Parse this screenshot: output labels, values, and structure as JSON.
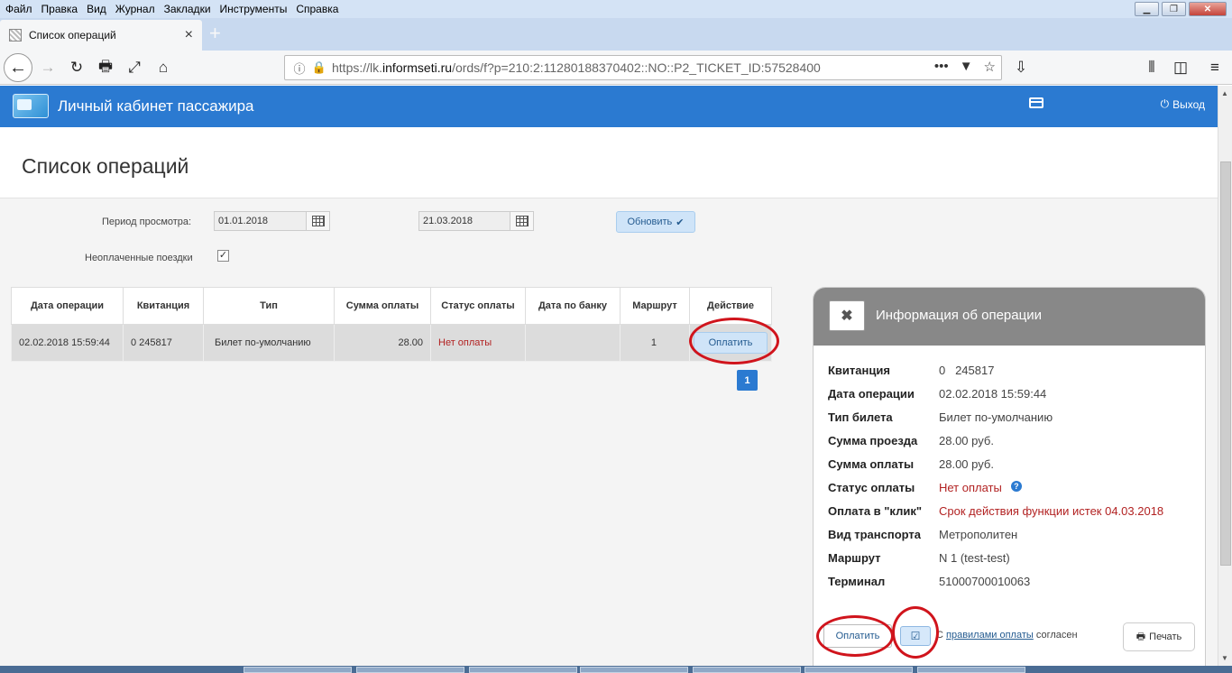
{
  "browser": {
    "menu": [
      "Файл",
      "Правка",
      "Вид",
      "Журнал",
      "Закладки",
      "Инструменты",
      "Справка"
    ],
    "tab_title": "Список операций",
    "url_prefix": "https://lk.",
    "url_host": "informseti.ru",
    "url_rest": "/ords/f?p=210:2:11280188370402::NO::P2_TICKET_ID:57528400"
  },
  "app": {
    "title": "Личный кабинет пассажира",
    "logout": "Выход"
  },
  "page": {
    "title": "Список операций"
  },
  "filter": {
    "period_label": "Период просмотра:",
    "date_from": "01.01.2018",
    "date_to": "21.03.2018",
    "refresh_label": "Обновить",
    "unpaid_label": "Неоплаченные поездки",
    "unpaid_checked": true
  },
  "table": {
    "headers": [
      "Дата операции",
      "Квитанция",
      "Тип",
      "Сумма оплаты",
      "Статус оплаты",
      "Дата по банку",
      "Маршрут",
      "Действие"
    ],
    "rows": [
      {
        "date": "02.02.2018 15:59:44",
        "receipt": "0 245817",
        "type": "Билет по-умолчанию",
        "amount": "28.00",
        "status": "Нет оплаты",
        "bank_date": "",
        "route": "1",
        "action": "Оплатить"
      }
    ],
    "page": "1"
  },
  "info": {
    "title": "Информация об операции",
    "fields": [
      {
        "label": "Квитанция",
        "value": "0   245817"
      },
      {
        "label": "Дата операции",
        "value": "02.02.2018 15:59:44"
      },
      {
        "label": "Тип билета",
        "value": "Билет по-умолчанию"
      },
      {
        "label": "Сумма проезда",
        "value": "28.00 руб."
      },
      {
        "label": "Сумма оплаты",
        "value": "28.00 руб."
      },
      {
        "label": "Статус оплаты",
        "value": "Нет оплаты"
      },
      {
        "label": "Оплата в \"клик\"",
        "value": "Срок действия функции истек 04.03.2018"
      },
      {
        "label": "Вид транспорта",
        "value": "Метрополитен"
      },
      {
        "label": "Маршрут",
        "value": "N 1 (test-test)"
      },
      {
        "label": "Терминал",
        "value": "51000700010063"
      }
    ],
    "pay_label": "Оплатить",
    "agree_prefix": "С ",
    "agree_link": "правилами оплаты",
    "agree_suffix": " согласен",
    "print_label": "Печать"
  },
  "colors": {
    "accent": "#2b7ad1",
    "status_red": "#b22222",
    "highlight_circle": "#d0141c"
  }
}
